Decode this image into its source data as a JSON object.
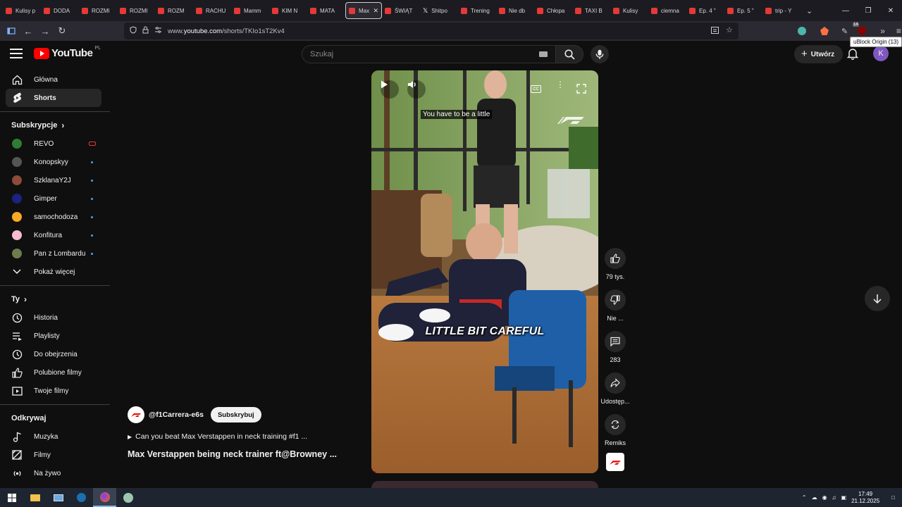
{
  "browser": {
    "tabs": [
      {
        "label": "Kulisy p",
        "icon": "youtube"
      },
      {
        "label": "DODA",
        "icon": "youtube"
      },
      {
        "label": "ROZMI",
        "icon": "youtube"
      },
      {
        "label": "ROZMI",
        "icon": "youtube"
      },
      {
        "label": "ROZM",
        "icon": "youtube"
      },
      {
        "label": "RACHU",
        "icon": "youtube"
      },
      {
        "label": "Mamm",
        "icon": "youtube"
      },
      {
        "label": "KIM N",
        "icon": "youtube"
      },
      {
        "label": "MATA",
        "icon": "youtube"
      },
      {
        "label": "Max",
        "icon": "youtube",
        "active": true
      },
      {
        "label": "ŚWIĄT",
        "icon": "youtube"
      },
      {
        "label": "Shitpo",
        "icon": "x"
      },
      {
        "label": "Trening",
        "icon": "youtube"
      },
      {
        "label": "Nie db",
        "icon": "youtube"
      },
      {
        "label": "Chłopa",
        "icon": "youtube"
      },
      {
        "label": "TAXI B",
        "icon": "youtube"
      },
      {
        "label": "Kulisy",
        "icon": "youtube"
      },
      {
        "label": "ciemna",
        "icon": "youtube"
      },
      {
        "label": "Ep. 4 \"",
        "icon": "youtube"
      },
      {
        "label": "Ep. 5 \"",
        "icon": "youtube"
      },
      {
        "label": "trip - Y",
        "icon": "youtube"
      }
    ],
    "url_prefix": "www.",
    "url_domain": "youtube.com",
    "url_path": "/shorts/TKIo1sT2Kv4",
    "ublock_badge": "14",
    "tooltip": "uBlock Origin (13)"
  },
  "youtube": {
    "logo_text": "YouTube",
    "country_code": "PL",
    "search_placeholder": "Szukaj",
    "create_label": "Utwórz",
    "avatar_letter": "K"
  },
  "sidebar": {
    "main": [
      {
        "label": "Główna",
        "icon": "home-icon"
      },
      {
        "label": "Shorts",
        "icon": "shorts-icon",
        "active": true
      }
    ],
    "subscriptions_title": "Subskrypcje",
    "subscriptions": [
      {
        "label": "REVO",
        "status": "live",
        "color": "#2e7d32"
      },
      {
        "label": "Konopskyy",
        "status": "new",
        "color": "#555555"
      },
      {
        "label": "SzklanaY2J",
        "status": "new",
        "color": "#8d4b3a"
      },
      {
        "label": "Gimper",
        "status": "new",
        "color": "#1a237e"
      },
      {
        "label": "samochodoza",
        "status": "new",
        "color": "#f9a825"
      },
      {
        "label": "Konfitura",
        "status": "new",
        "color": "#f8bbd0"
      },
      {
        "label": "Pan z Lombardu",
        "status": "new",
        "color": "#6d7b4f"
      }
    ],
    "show_more": "Pokaż więcej",
    "you_title": "Ty",
    "you": [
      {
        "label": "Historia",
        "icon": "history-icon"
      },
      {
        "label": "Playlisty",
        "icon": "playlists-icon"
      },
      {
        "label": "Do obejrzenia",
        "icon": "watch-later-icon"
      },
      {
        "label": "Polubione filmy",
        "icon": "liked-icon"
      },
      {
        "label": "Twoje filmy",
        "icon": "your-videos-icon"
      }
    ],
    "explore_title": "Odkrywaj",
    "explore": [
      {
        "label": "Muzyka",
        "icon": "music-icon"
      },
      {
        "label": "Filmy",
        "icon": "movies-icon"
      },
      {
        "label": "Na żywo",
        "icon": "live-icon"
      }
    ]
  },
  "short": {
    "caption_top": "You have to be a little",
    "caption_main": "LITTLE BIT CAREFUL",
    "progress": 0.02,
    "channel": "@f1Carrera-e6s",
    "subscribe_label": "Subskrybuj",
    "music": "Can you beat Max Verstappen in neck training #f1 ...",
    "title": "Max Verstappen being neck trainer ft@Browney ..."
  },
  "actions": {
    "likes": "79 tys.",
    "dislike": "Nie ...",
    "comments": "283",
    "share": "Udostęp...",
    "remix": "Remiks"
  },
  "taskbar": {
    "time": "17:49",
    "date": "21.12.2025"
  }
}
